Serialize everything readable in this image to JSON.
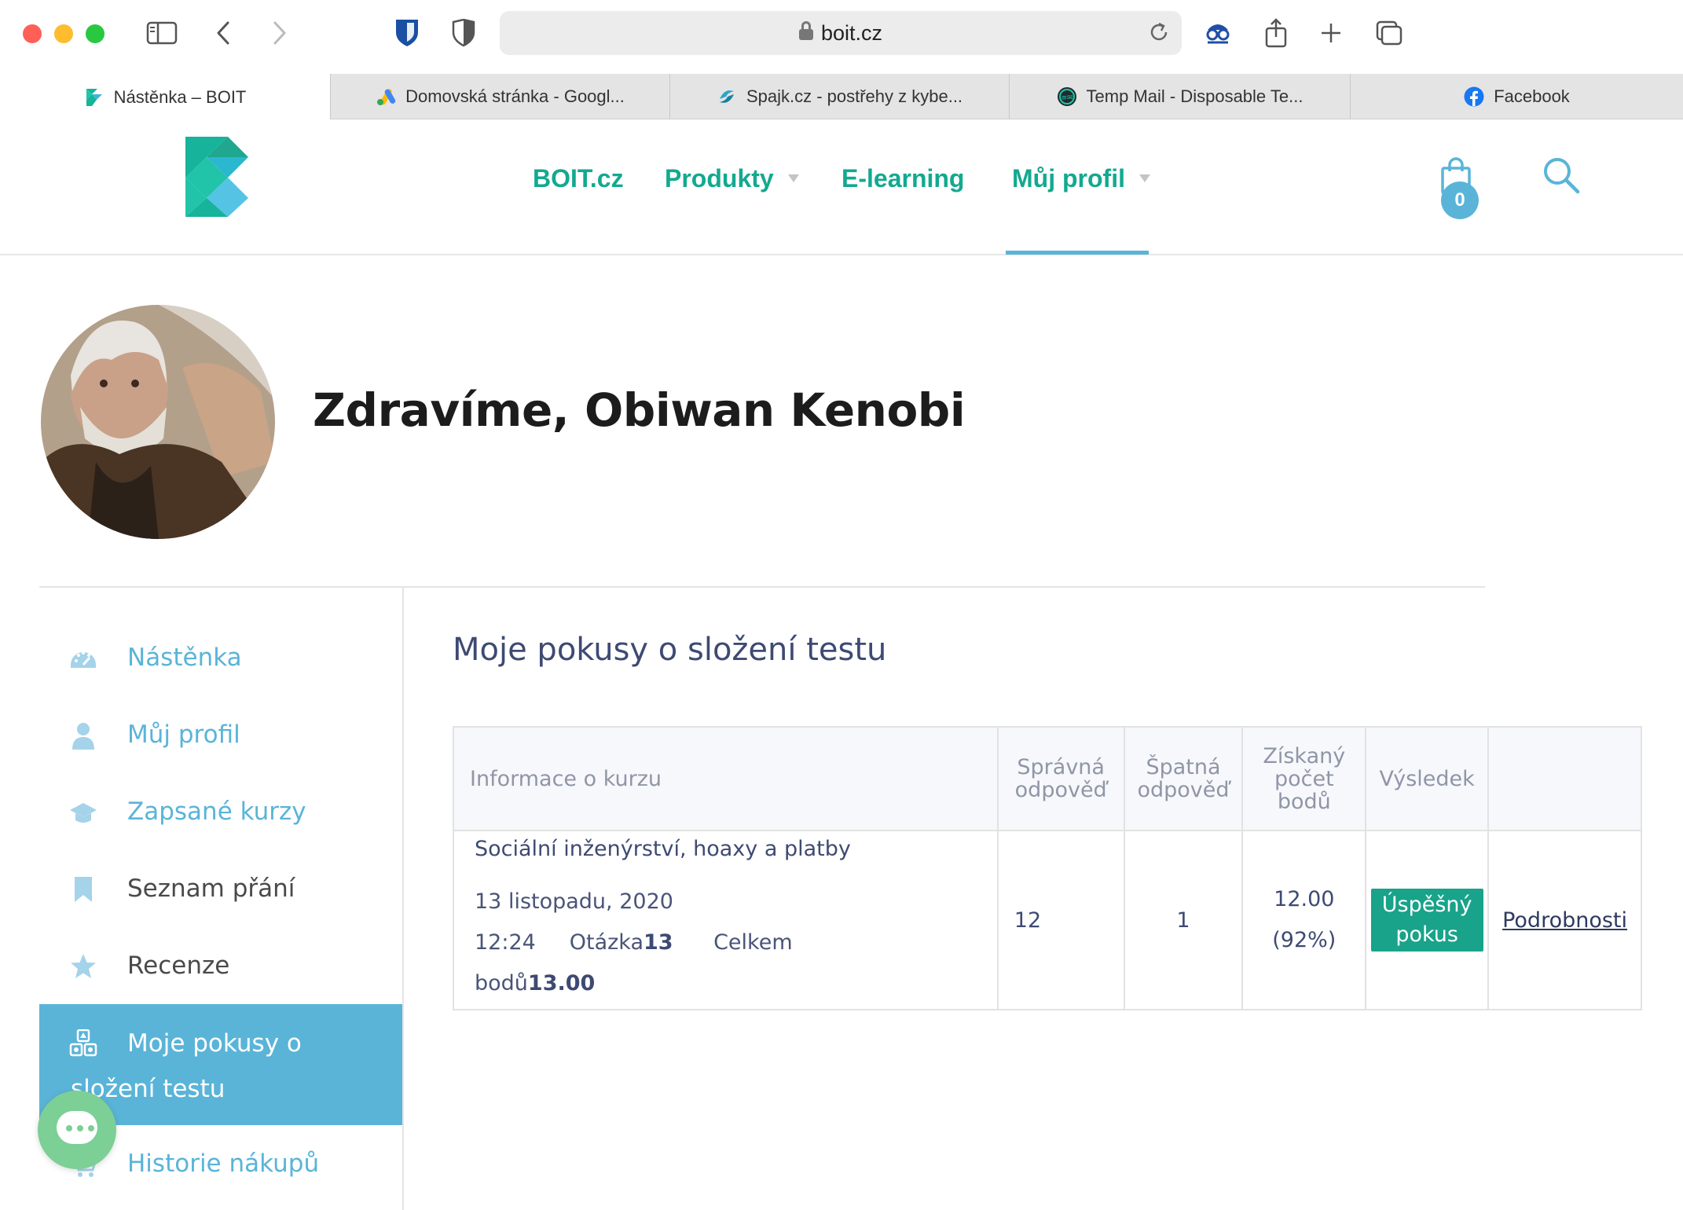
{
  "browser": {
    "url": "boit.cz",
    "tabs": [
      {
        "title": "Nástěnka – BOIT",
        "active": true
      },
      {
        "title": "Domovská stránka - Googl...",
        "active": false
      },
      {
        "title": "Spajk.cz - postřehy z kybe...",
        "active": false
      },
      {
        "title": "Temp Mail - Disposable Te...",
        "active": false
      },
      {
        "title": "Facebook",
        "active": false
      }
    ]
  },
  "header": {
    "nav": [
      "BOIT.cz",
      "Produkty",
      "E-learning",
      "Můj profil"
    ],
    "cart_count": "0"
  },
  "profile": {
    "greeting": "Zdravíme, Obiwan Kenobi"
  },
  "sidebar": {
    "items": [
      "Nástěnka",
      "Můj profil",
      "Zapsané kurzy",
      "Seznam přání",
      "Recenze",
      "Historie nákupů"
    ],
    "active_line1": "Moje pokusy o",
    "active_line2": "složení testu"
  },
  "main": {
    "title": "Moje pokusy o složení testu",
    "table": {
      "headers": [
        "Informace o kurzu",
        "Správná",
        "odpověď",
        "Špatná",
        "odpověď",
        "Získaný",
        "počet",
        "bodů",
        "Výsledek"
      ],
      "row": {
        "course": "Sociální inženýrství, hoaxy a platby",
        "date": "13 listopadu, 2020 12:24",
        "question_label": "Otázka",
        "question_count": "13",
        "total_label_1": "Celkem",
        "total_label_2": "bodů",
        "total_points": "13.00",
        "correct": "12",
        "wrong": "1",
        "points": "12.00",
        "percent": "(92%)",
        "result_1": "Úspěšný",
        "result_2": "pokus",
        "details": "Podrobnosti"
      }
    }
  },
  "colors": {
    "brand_green": "#12a98f",
    "accent_blue": "#5ab4d8",
    "heading_navy": "#3e4a73",
    "success": "#18a38a"
  }
}
